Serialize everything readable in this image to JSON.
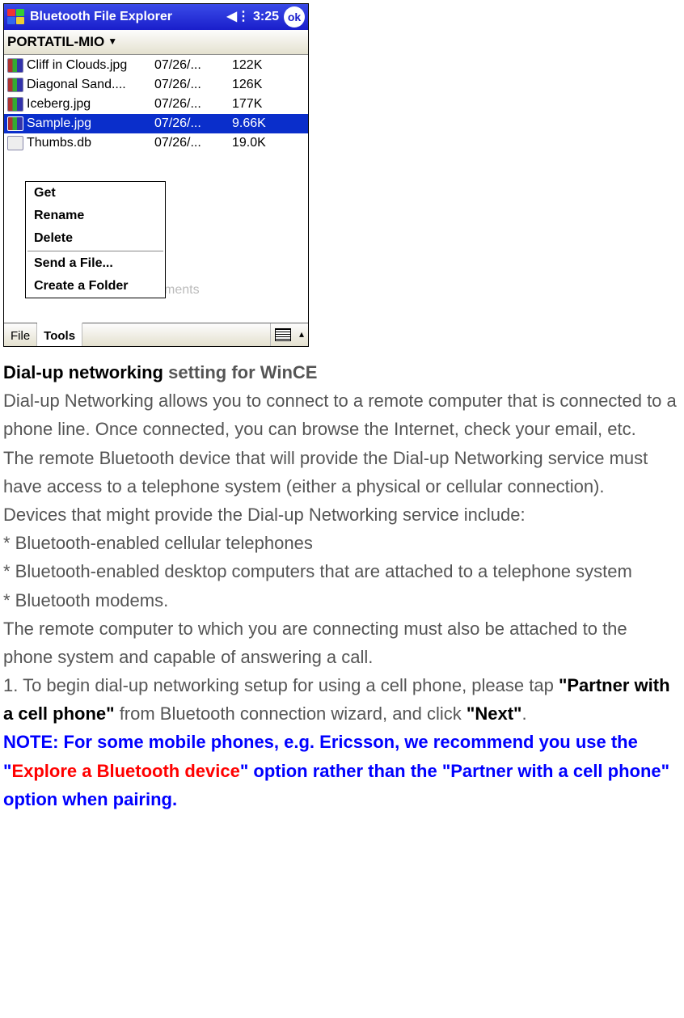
{
  "screenshot": {
    "title": "Bluetooth File Explorer",
    "time": "3:25",
    "ok": "ok",
    "toolbar_label": "PORTATIL-MIO",
    "files": [
      {
        "name": "Cliff in Clouds.jpg",
        "date": "07/26/...",
        "size": "122K",
        "icon": "img"
      },
      {
        "name": "Diagonal Sand....",
        "date": "07/26/...",
        "size": "126K",
        "icon": "img"
      },
      {
        "name": "Iceberg.jpg",
        "date": "07/26/...",
        "size": "177K",
        "icon": "img"
      },
      {
        "name": "Sample.jpg",
        "date": "07/26/...",
        "size": "9.66K",
        "icon": "img",
        "selected": true
      },
      {
        "name": "Thumbs.db",
        "date": "07/26/...",
        "size": "19.0K",
        "icon": "db"
      }
    ],
    "context_menu": [
      "Get",
      "Rename",
      "Delete",
      "—",
      "Send a File...",
      "Create a Folder"
    ],
    "path_hint": "ments",
    "bottom": {
      "file": "File",
      "tools": "Tools"
    }
  },
  "doc": {
    "heading_strong": "Dial-up networking",
    "heading_rest": " setting for WinCE",
    "p1": "Dial-up Networking allows you to connect to a remote computer that is connected to a phone line. Once connected, you can browse the Internet, check your email, etc.",
    "p2": "The remote Bluetooth device that will provide the Dial-up Networking service must have access to a telephone system (either a physical or cellular connection).",
    "p3": "Devices that might provide the Dial-up Networking service include:",
    "b1": "* Bluetooth-enabled cellular telephones",
    "b2": "* Bluetooth-enabled desktop computers that are attached to a telephone system",
    "b3": "* Bluetooth modems.",
    "p4": "The remote computer to which you are connecting must also be attached to the phone system and capable of answering a call.",
    "step1_a": "1. To begin dial-up networking setup for using a cell phone, please tap ",
    "step1_b": "\"Partner with a cell phone\"",
    "step1_c": " from Bluetooth connection wizard, and click ",
    "step1_d": "\"Next\"",
    "step1_e": ".",
    "note_a": "NOTE: For some mobile phones, e.g. Ericsson, we recommend you use the \"",
    "note_red": "Explore a Bluetooth device",
    "note_b": "\" option rather than the \"Partner with a cell phone\" option when pairing."
  }
}
